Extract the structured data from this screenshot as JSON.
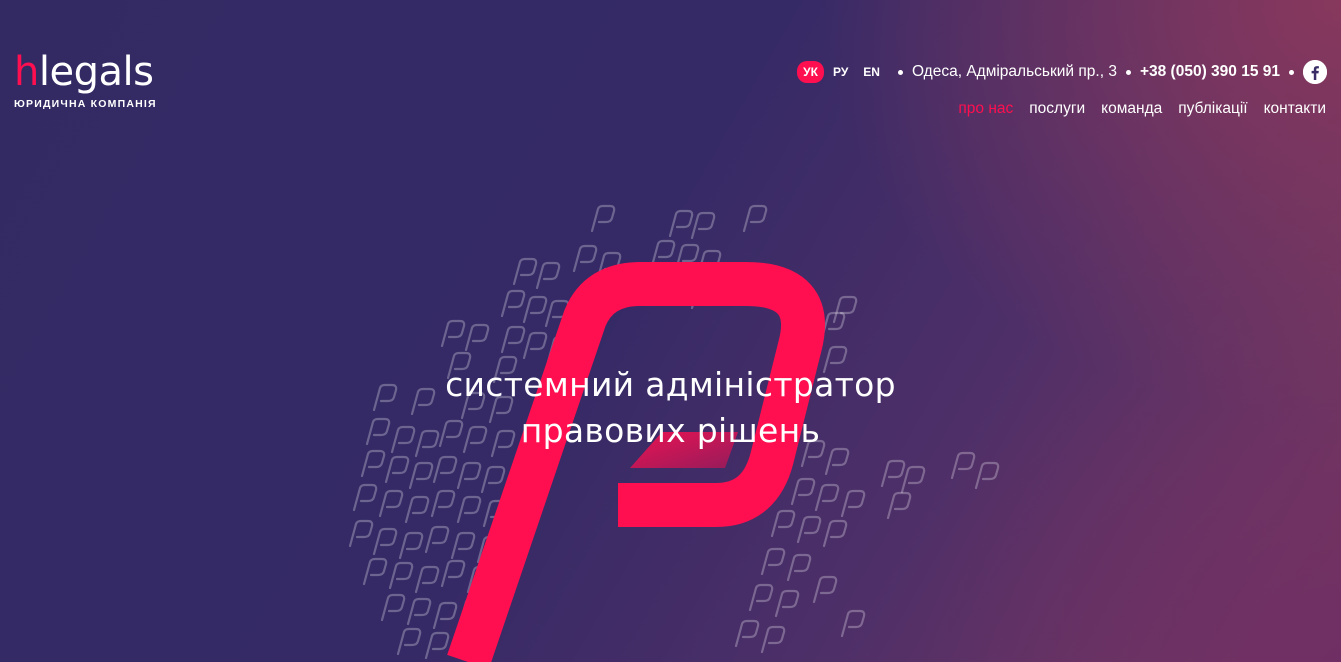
{
  "brand": {
    "logo_h": "h",
    "logo_rest": "legals",
    "subtitle": "ЮРИДИЧНА КОМПАНІЯ"
  },
  "languages": [
    {
      "label": "УК",
      "active": true
    },
    {
      "label": "РУ",
      "active": false
    },
    {
      "label": "EN",
      "active": false
    }
  ],
  "contact": {
    "address": "Одеса, Адміральський пр., 3",
    "phone": "+38 (050) 390 15 91",
    "social_icon": "facebook-icon"
  },
  "nav": [
    {
      "label": "про нас",
      "active": true
    },
    {
      "label": "послуги",
      "active": false
    },
    {
      "label": "команда",
      "active": false
    },
    {
      "label": "публікації",
      "active": false
    },
    {
      "label": "контакти",
      "active": false
    }
  ],
  "hero": {
    "line1": "системний адміністратор",
    "line2": "правових рішень"
  },
  "colors": {
    "accent": "#ff0f4f",
    "background_dark": "#332a64",
    "background_warm": "#8a385c"
  }
}
